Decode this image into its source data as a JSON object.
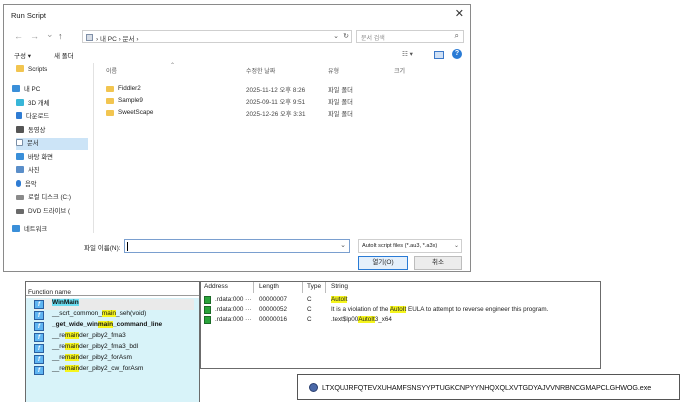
{
  "dialog": {
    "title": "Run Script",
    "close_glyph": "✕",
    "nav": {
      "back": "←",
      "forward": "→",
      "recent": "⌄",
      "up": "↑"
    },
    "address": {
      "crumbs": "› 내 PC › 문서 ›",
      "dropdown": "⌄",
      "refresh": "↻"
    },
    "search_placeholder": "문서 검색",
    "search_icon": "⌕",
    "toolbar": {
      "organize": "구성 ▾",
      "new_folder": "새 폴더",
      "view_menu": "☷ ▾",
      "help": "?"
    },
    "nav_pane": [
      {
        "label": "Scripts",
        "icon": "folder-icon",
        "color": "#f2c550"
      },
      {
        "label": "내 PC",
        "icon": "pc-icon",
        "color": "#3a8fd9"
      },
      {
        "label": "3D 개체",
        "icon": "3d-objects-icon",
        "color": "#38b6d8"
      },
      {
        "label": "다운로드",
        "icon": "download-icon",
        "color": "#2f7cd3"
      },
      {
        "label": "동영상",
        "icon": "video-icon",
        "color": "#555555"
      },
      {
        "label": "문서",
        "icon": "document-icon",
        "color": "#7a8fa8",
        "selected": true
      },
      {
        "label": "바탕 화면",
        "icon": "desktop-icon",
        "color": "#3a8fd9"
      },
      {
        "label": "사진",
        "icon": "pictures-icon",
        "color": "#5a8ec9"
      },
      {
        "label": "음악",
        "icon": "music-icon",
        "color": "#2f7cd3"
      },
      {
        "label": "로컬 디스크 (C:)",
        "icon": "disk-icon",
        "color": "#8a8a8a"
      },
      {
        "label": "DVD 드라이브 (",
        "icon": "dvd-icon",
        "color": "#6a6a6a"
      },
      {
        "label": "네트워크",
        "icon": "network-icon",
        "color": "#3a8fd9"
      }
    ],
    "columns": {
      "name": "이름",
      "date": "수정한 날짜",
      "type": "유형",
      "size": "크기"
    },
    "files": [
      {
        "name": "Fiddler2",
        "date": "2025-11-12 오후 8:26",
        "type": "파일 폴더"
      },
      {
        "name": "Sample9",
        "date": "2025-09-11 오후 9:51",
        "type": "파일 폴더"
      },
      {
        "name": "SweetScape",
        "date": "2025-12-26 오후 3:31",
        "type": "파일 폴더"
      }
    ],
    "filename_label": "파일 이름(N):",
    "filename_value": "",
    "filter": "AutoIt script files (*.au3, *.a3x)",
    "open_button": "열기(O)",
    "cancel_button": "취소"
  },
  "functions": {
    "header": "Function name",
    "rows": [
      {
        "pre": "",
        "hl": "WinMain",
        "post": "",
        "bold": true,
        "hl_color": "cyan",
        "selected": true
      },
      {
        "pre": "__scrt_common_",
        "hl": "main",
        "post": "_seh(void)",
        "bold": false
      },
      {
        "pre": "_get_wide_win",
        "hl": "main",
        "post": "_command_line",
        "bold": true
      },
      {
        "pre": "__re",
        "hl": "main",
        "post": "der_piby2_fma3",
        "bold": false
      },
      {
        "pre": "__re",
        "hl": "main",
        "post": "der_piby2_fma3_bdl",
        "bold": false
      },
      {
        "pre": "__re",
        "hl": "main",
        "post": "der_piby2_forAsm",
        "bold": false
      },
      {
        "pre": "__re",
        "hl": "main",
        "post": "der_piby2_cw_forAsm",
        "bold": false
      }
    ]
  },
  "strings": {
    "headers": {
      "address": "Address",
      "length": "Length",
      "type": "Type",
      "string": "String"
    },
    "rows": [
      {
        "address": ".rdata:000 ···",
        "length": "00000007",
        "type": "C",
        "pre": "",
        "hl": "AutoIt",
        "post": ""
      },
      {
        "address": ".rdata:000 ···",
        "length": "00000052",
        "type": "C",
        "pre": "It is a violation of the ",
        "hl": "AutoIt",
        "post": " EULA to attempt to reverse engineer this program."
      },
      {
        "address": ".rdata:000 ···",
        "length": "00000016",
        "type": "C",
        "pre": ".text$lp00",
        "hl": "AutoIt",
        "post": "3_x64"
      }
    ]
  },
  "file_label": "LTXQUJRFQTEVXUHAMFSNSYYPTUGKCNPYYNHQXQLXVTGDYAJVVNRBNCGMAPCLGHWOG.exe"
}
